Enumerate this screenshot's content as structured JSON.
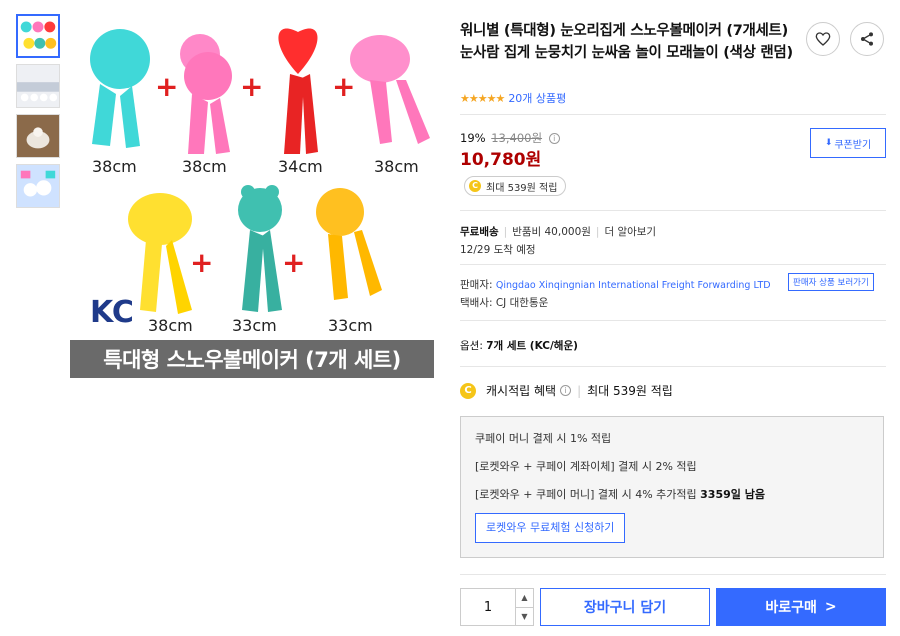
{
  "thumbnails": [
    {
      "label": "thumb-1",
      "colors": [
        "#40d8d8",
        "#ff77bb",
        "#ffe030"
      ]
    },
    {
      "label": "thumb-2",
      "colors": [
        "#dfe3ea",
        "#c4ccd8"
      ]
    },
    {
      "label": "thumb-3",
      "colors": [
        "#8b6a4a",
        "#e8e0d8"
      ]
    },
    {
      "label": "thumb-4",
      "colors": [
        "#b8d8ff",
        "#ffffff"
      ]
    }
  ],
  "main_image": {
    "sizes": [
      "38cm",
      "38cm",
      "34cm",
      "38cm",
      "38cm",
      "33cm",
      "33cm"
    ],
    "plus_sign": "+",
    "banner": "특대형 스노우볼메이커 (7개 세트)",
    "kc_mark": "KC"
  },
  "product": {
    "title": "워니별 (특대형) 눈오리집게 스노우볼메이커 (7개세트) 눈사람 집게 눈뭉치기 눈싸움 놀이 모래놀이 (색상 랜덤)",
    "stars": "★★★★★",
    "review_count": "20개 상품평",
    "discount_rate": "19%",
    "original_price": "13,400원",
    "price": "10,780원",
    "coupon_label": "쿠폰받기",
    "cash_badge": "최대 539원 적립"
  },
  "shipping": {
    "free": "무료배송",
    "return_fee": "반품비 40,000원",
    "more": "더 알아보기",
    "arrival": "12/29 도착 예정"
  },
  "seller": {
    "label": "판매자:",
    "name": "Qingdao Xinqingnian International Freight Forwarding LTD",
    "other_products": "판매자 상품 보러가기",
    "courier": "택배사: CJ 대한통운"
  },
  "option": {
    "label": "옵션:",
    "value": "7개 세트 (KC/해운)"
  },
  "cash_benefit": {
    "label": "캐시적립 혜택",
    "max": "최대 539원 적립",
    "lines": [
      "쿠페이 머니 결제 시 1% 적립",
      "[로켓와우 + 쿠페이 계좌이체] 결제 시 2% 적립",
      "[로켓와우 + 쿠페이 머니] 결제 시 4% 추가적립"
    ],
    "days_left": "3359일 남음",
    "trial_button": "로켓와우 무료체험 신청하기"
  },
  "purchase": {
    "quantity": "1",
    "cart_button": "장바구니 담기",
    "buy_button": "바로구매",
    "buy_arrow": ">"
  },
  "colors": {
    "accent": "#346aff",
    "price": "#ae0000",
    "star": "#f5a623"
  }
}
